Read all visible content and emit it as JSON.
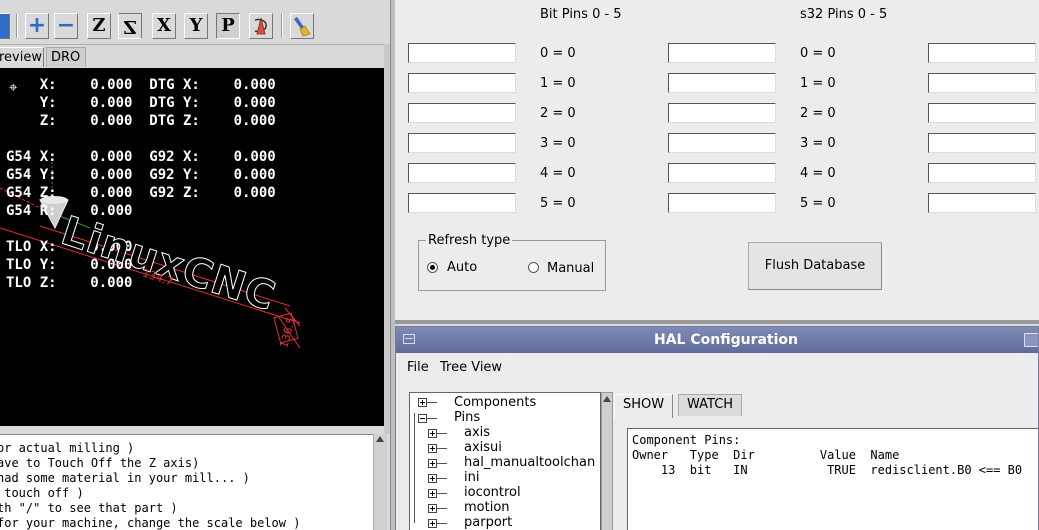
{
  "axis": {
    "toolbar": {
      "buttons": [
        {
          "name": "open-icon-partial",
          "glyph": ""
        },
        {
          "name": "zoom-in-icon",
          "glyph": "+"
        },
        {
          "name": "zoom-out-icon",
          "glyph": "−"
        },
        {
          "name": "view-z-icon",
          "glyph": "Z"
        },
        {
          "name": "view-rotated-z-icon",
          "glyph": "Z"
        },
        {
          "name": "view-x-icon",
          "glyph": "X"
        },
        {
          "name": "view-y-icon",
          "glyph": "Y"
        },
        {
          "name": "view-p-icon",
          "glyph": "P"
        },
        {
          "name": "rotate-view-icon",
          "glyph": ""
        },
        {
          "name": "clear-plot-icon",
          "glyph": ""
        }
      ]
    },
    "tabs": {
      "preview": "review",
      "dro": "DRO"
    },
    "dro": {
      "line1": "    X:    0.000  DTG X:    0.000",
      "line2": "    Y:    0.000  DTG Y:    0.000",
      "line3": "    Z:    0.000  DTG Z:    0.000",
      "line4": "G54 X:    0.000  G92 X:    0.000",
      "line5": "G54 Y:    0.000  G92 Y:    0.000",
      "line6": "G54 Z:    0.000  G92 Z:    0.000",
      "line7": "G54 R:    0.000",
      "line8": "TLO X:    0.000",
      "line9": "TLO Y:    0.000",
      "line10": "TLO Z:    0.000"
    },
    "preview_labels": {
      "logo": "LinuxCNC",
      "dim1": "134.7",
      "dim2": "136.5"
    },
    "gcode_lines": [
      "or actual milling )",
      "ave to Touch Off the Z axis)",
      "had some material in your mill... )",
      " touch off )",
      "th \"/\" to see that part )",
      "for your machine, change the scale below )"
    ]
  },
  "pins_panel": {
    "bit_header": "Bit Pins 0 - 5",
    "s32_header": "s32 Pins 0 - 5",
    "bit_values": [
      "0 = 0",
      "1 = 0",
      "2 = 0",
      "3 = 0",
      "4 = 0",
      "5 = 0"
    ],
    "s32_values": [
      "0 = 0",
      "1 = 0",
      "2 = 0",
      "3 = 0",
      "4 = 0",
      "5 = 0"
    ],
    "refresh": {
      "legend": "Refresh type",
      "auto": "Auto",
      "manual": "Manual",
      "selected": "Auto"
    },
    "flush_button": "Flush Database"
  },
  "hal": {
    "title": "HAL Configuration",
    "menu": {
      "file": "File",
      "tree_view": "Tree View"
    },
    "tree": {
      "components": "Components",
      "pins": "Pins",
      "children": [
        "axis",
        "axisui",
        "hal_manualtoolchange",
        "ini",
        "iocontrol",
        "motion",
        "parport"
      ]
    },
    "tabs": {
      "show": "SHOW",
      "watch": "WATCH"
    },
    "show": {
      "heading": "Component Pins:",
      "columns": "Owner   Type  Dir         Value  Name",
      "row": "    13  bit   IN           TRUE  redisclient.B0 <== B0"
    }
  },
  "colors": {
    "hal_title_bar": "#6a77a8",
    "preview_bg": "#000000",
    "panel_bg": "#ececec"
  }
}
